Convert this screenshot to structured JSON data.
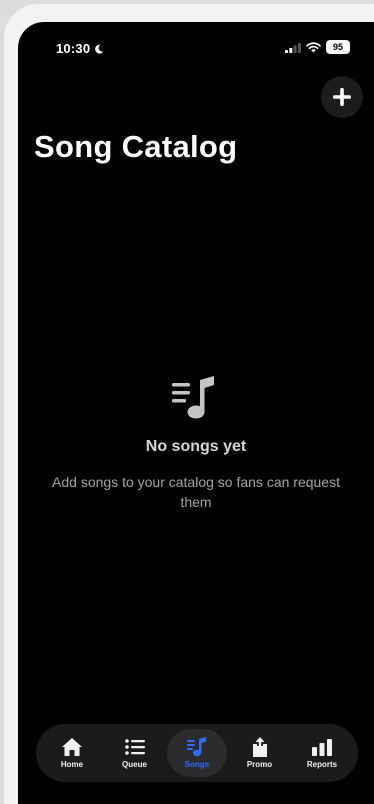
{
  "status_bar": {
    "time": "10:30",
    "battery": "95"
  },
  "header": {
    "title": "Song Catalog",
    "add_icon": "plus-icon"
  },
  "empty_state": {
    "icon": "music-list-icon",
    "title": "No songs yet",
    "description": "Add songs to your catalog so fans can request them"
  },
  "tabs": [
    {
      "label": "Home",
      "icon": "house-icon",
      "active": false
    },
    {
      "label": "Queue",
      "icon": "list-icon",
      "active": false
    },
    {
      "label": "Songs",
      "icon": "music-list-icon",
      "active": true
    },
    {
      "label": "Promo",
      "icon": "share-icon",
      "active": false
    },
    {
      "label": "Reports",
      "icon": "bar-chart-icon",
      "active": false
    }
  ],
  "colors": {
    "accent": "#2f6bff",
    "background": "#000000",
    "surface": "#1b1b1d"
  }
}
